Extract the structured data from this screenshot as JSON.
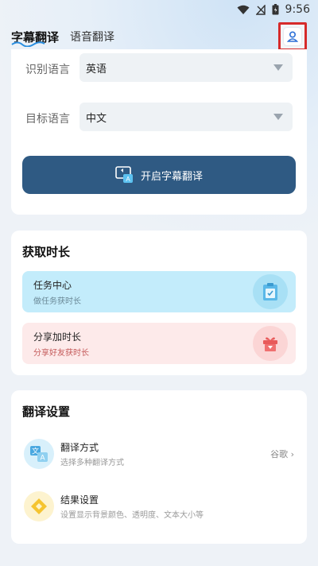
{
  "status_bar": {
    "time": "9:56"
  },
  "header": {
    "tabs": [
      {
        "label": "字幕翻译",
        "active": true
      },
      {
        "label": "语音翻译",
        "active": false
      }
    ]
  },
  "language_card": {
    "source": {
      "label": "识别语言",
      "value": "英语"
    },
    "target": {
      "label": "目标语言",
      "value": "中文"
    },
    "start_button": "开启字幕翻译"
  },
  "duration_card": {
    "title": "获取时长",
    "task": {
      "title": "任务中心",
      "subtitle": "做任务获时长"
    },
    "share": {
      "title": "分享加时长",
      "subtitle": "分享好友获时长"
    }
  },
  "settings_card": {
    "title": "翻译设置",
    "method": {
      "title": "翻译方式",
      "subtitle": "选择多种翻译方式",
      "value": "谷歌 ›"
    },
    "result": {
      "title": "结果设置",
      "subtitle": "设置显示背景颜色、透明度、文本大小等"
    }
  },
  "colors": {
    "primary_button": "#2f5a83",
    "highlight_border": "#d62a2a"
  }
}
